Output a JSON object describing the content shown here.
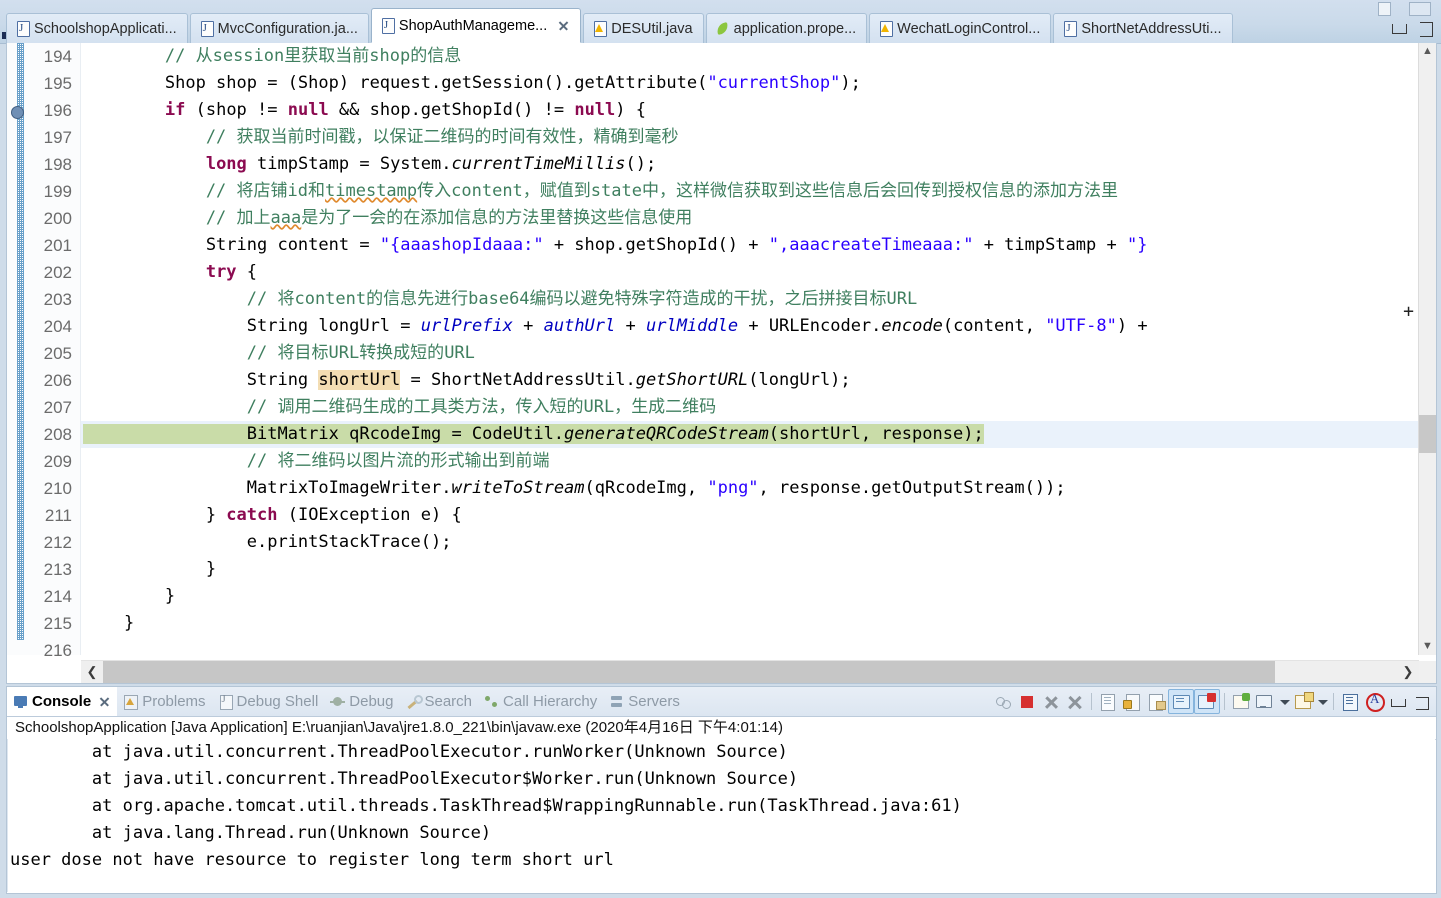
{
  "window": {
    "minimize_label": "minimize",
    "restore_label": "restore"
  },
  "tabs": [
    {
      "label": "SchoolshopApplicati...",
      "icon": "java-file-icon",
      "active": false,
      "closeable": false
    },
    {
      "label": "MvcConfiguration.ja...",
      "icon": "java-file-icon",
      "active": false,
      "closeable": false
    },
    {
      "label": "ShopAuthManageme...",
      "icon": "java-file-icon",
      "active": true,
      "closeable": true
    },
    {
      "label": "DESUtil.java",
      "icon": "java-warning-file-icon",
      "active": false,
      "closeable": false
    },
    {
      "label": "application.prope...",
      "icon": "properties-leaf-icon",
      "active": false,
      "closeable": false
    },
    {
      "label": "WechatLoginControl...",
      "icon": "java-warning-file-icon",
      "active": false,
      "closeable": false
    },
    {
      "label": "ShortNetAddressUti...",
      "icon": "java-file-icon",
      "active": false,
      "closeable": false
    }
  ],
  "editor": {
    "first_line": 194,
    "last_line": 216,
    "current_line": 208,
    "selected_text": "BitMatrix qRcodeImg = CodeUtil.generateQRCodeStream(shortUrl, response);",
    "occurrence_highlight": "shortUrl",
    "lines": [
      {
        "n": "194",
        "text": "        // 从session里获取当前shop的信息"
      },
      {
        "n": "195",
        "text": "        Shop shop = (Shop) request.getSession().getAttribute(\"currentShop\");"
      },
      {
        "n": "196",
        "text": "        if (shop != null && shop.getShopId() != null) {"
      },
      {
        "n": "197",
        "text": "            // 获取当前时间戳，以保证二维码的时间有效性，精确到毫秒"
      },
      {
        "n": "198",
        "text": "            long timpStamp = System.currentTimeMillis();"
      },
      {
        "n": "199",
        "text": "            // 将店铺id和timestamp传入content，赋值到state中，这样微信获取到这些信息后会回传到授权信息的添加方法里"
      },
      {
        "n": "200",
        "text": "            // 加上aaa是为了一会的在添加信息的方法里替换这些信息使用"
      },
      {
        "n": "201",
        "text": "            String content = \"{aaashopIdaaa:\" + shop.getShopId() + \",aaacreateTimeaaa:\" + timpStamp + \"}"
      },
      {
        "n": "202",
        "text": "            try {"
      },
      {
        "n": "203",
        "text": "                // 将content的信息先进行base64编码以避免特殊字符造成的干扰，之后拼接目标URL"
      },
      {
        "n": "204",
        "text": "                String longUrl = urlPrefix + authUrl + urlMiddle + URLEncoder.encode(content, \"UTF-8\") +"
      },
      {
        "n": "205",
        "text": "                // 将目标URL转换成短的URL"
      },
      {
        "n": "206",
        "text": "                String shortUrl = ShortNetAddressUtil.getShortURL(longUrl);"
      },
      {
        "n": "207",
        "text": "                // 调用二维码生成的工具类方法，传入短的URL，生成二维码"
      },
      {
        "n": "208",
        "text": "                BitMatrix qRcodeImg = CodeUtil.generateQRCodeStream(shortUrl, response);"
      },
      {
        "n": "209",
        "text": "                // 将二维码以图片流的形式输出到前端"
      },
      {
        "n": "210",
        "text": "                MatrixToImageWriter.writeToStream(qRcodeImg, \"png\", response.getOutputStream());"
      },
      {
        "n": "211",
        "text": "            } catch (IOException e) {"
      },
      {
        "n": "212",
        "text": "                e.printStackTrace();"
      },
      {
        "n": "213",
        "text": "            }"
      },
      {
        "n": "214",
        "text": "        }"
      },
      {
        "n": "215",
        "text": "    }"
      },
      {
        "n": "216",
        "text": ""
      }
    ]
  },
  "console_panel": {
    "tabs": [
      {
        "label": "Console",
        "icon": "console-icon",
        "active": true,
        "closeable": true
      },
      {
        "label": "Problems",
        "icon": "problems-icon",
        "active": false,
        "closeable": false
      },
      {
        "label": "Debug Shell",
        "icon": "debugshell-icon",
        "active": false,
        "closeable": false
      },
      {
        "label": "Debug",
        "icon": "debug-icon",
        "active": false,
        "closeable": false
      },
      {
        "label": "Search",
        "icon": "search-icon",
        "active": false,
        "closeable": false
      },
      {
        "label": "Call Hierarchy",
        "icon": "callhierarchy-icon",
        "active": false,
        "closeable": false
      },
      {
        "label": "Servers",
        "icon": "servers-icon",
        "active": false,
        "closeable": false
      }
    ],
    "toolbar": [
      {
        "name": "link-with-editor-button",
        "icon": "link-icon"
      },
      {
        "name": "terminate-button",
        "icon": "stop-icon"
      },
      {
        "name": "remove-launch-button",
        "icon": "remove-icon"
      },
      {
        "name": "remove-all-terminated-button",
        "icon": "remove-all-icon"
      },
      {
        "name": "clear-console-button",
        "icon": "clear-console-icon"
      },
      {
        "name": "scroll-lock-button",
        "icon": "lock-icon"
      },
      {
        "name": "word-wrap-button",
        "icon": "wrap-icon"
      },
      {
        "name": "show-console-on-output-button",
        "icon": "show-console-stdout-icon"
      },
      {
        "name": "show-console-on-error-button",
        "icon": "show-console-stderr-icon"
      },
      {
        "name": "pin-console-button",
        "icon": "pin-icon"
      },
      {
        "name": "display-selected-console-button",
        "icon": "display-console-icon"
      },
      {
        "name": "display-console-dropdown",
        "icon": "chevron-down-icon"
      },
      {
        "name": "open-console-button",
        "icon": "new-console-icon"
      },
      {
        "name": "open-console-dropdown",
        "icon": "chevron-down-icon"
      },
      {
        "name": "view-menu-button",
        "icon": "view-menu-icon"
      },
      {
        "name": "ansi-console-button",
        "icon": "ansi-icon"
      },
      {
        "name": "minimize-panel-button",
        "icon": "minimize-icon"
      },
      {
        "name": "maximize-panel-button",
        "icon": "maximize-icon"
      }
    ],
    "launch_label": "SchoolshopApplication [Java Application] E:\\ruanjian\\Java\\jre1.8.0_221\\bin\\javaw.exe (2020年4月16日 下午4:01:14)",
    "output": [
      "\tat java.util.concurrent.ThreadPoolExecutor.runWorker(Unknown Source)",
      "\tat java.util.concurrent.ThreadPoolExecutor$Worker.run(Unknown Source)",
      "\tat org.apache.tomcat.util.threads.TaskThread$WrappingRunnable.run(TaskThread.java:61)",
      "\tat java.lang.Thread.run(Unknown Source)",
      "user dose not have resource to register long term short url"
    ]
  },
  "colors": {
    "selection_green": "#c9dca8",
    "current_line_blue": "#eaf2fb",
    "occurrence_tan": "#f3ddb3",
    "comment_green": "#3f7f5f",
    "string_blue": "#2a00ff",
    "keyword_purple": "#8b0a50",
    "field_blue": "#0000c0",
    "chrome_blue": "#cadaea"
  }
}
